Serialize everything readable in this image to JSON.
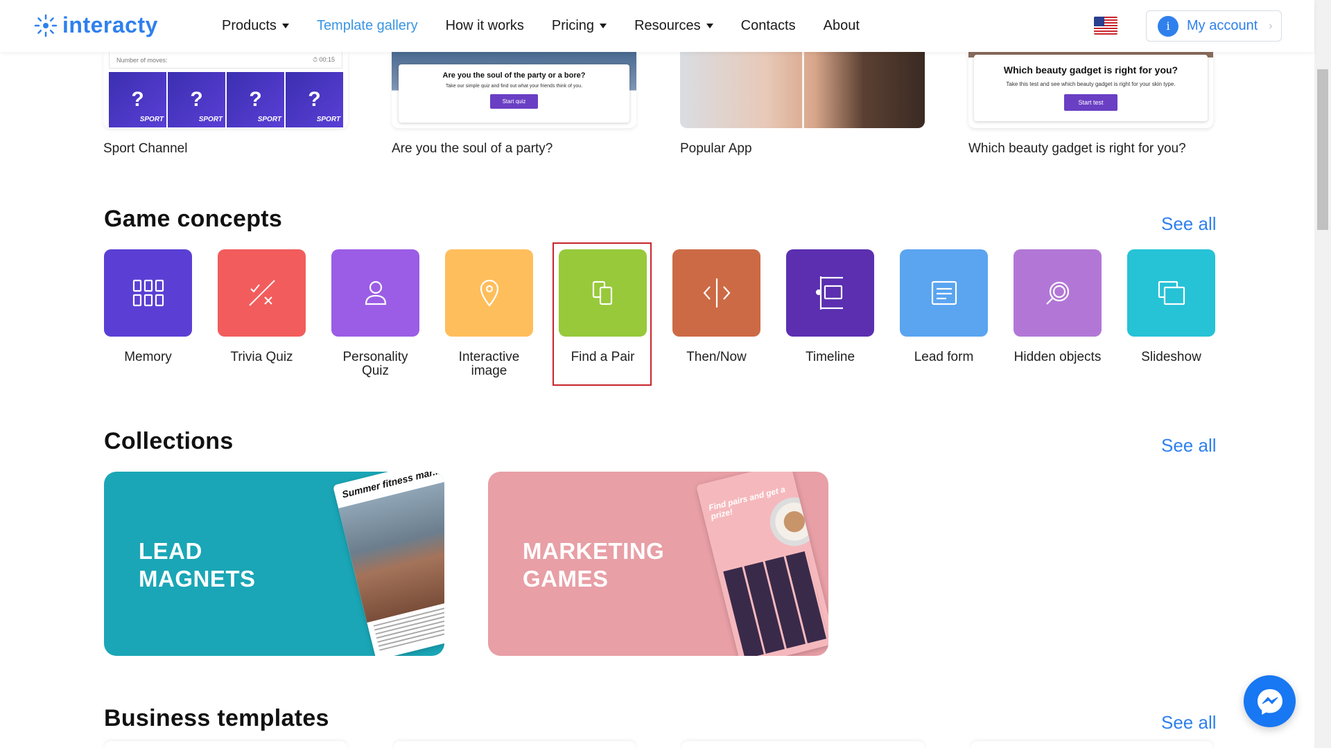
{
  "header": {
    "logo_text": "interacty",
    "nav": [
      {
        "label": "Products",
        "dropdown": true
      },
      {
        "label": "Template gallery",
        "dropdown": false,
        "active": true
      },
      {
        "label": "How it works",
        "dropdown": false
      },
      {
        "label": "Pricing",
        "dropdown": true
      },
      {
        "label": "Resources",
        "dropdown": true
      },
      {
        "label": "Contacts",
        "dropdown": false
      },
      {
        "label": "About",
        "dropdown": false
      }
    ],
    "account_icon_letter": "i",
    "account_label": "My account",
    "accent_color": "#2f80ed"
  },
  "top_templates": [
    {
      "label": "Sport Channel",
      "moves_label": "Number of moves:",
      "timer": "00:15",
      "tile_mark": "?",
      "tile_brand": "SPORT"
    },
    {
      "label": "Are you the soul of a party?",
      "quiz_title": "Are you the soul of the party or a bore?",
      "quiz_subtitle": "Take our simple quiz and find out what your friends think of you.",
      "button": "Start quiz"
    },
    {
      "label": "Popular App"
    },
    {
      "label": "Which beauty gadget is right for you?",
      "quiz_title": "Which beauty gadget is right for you?",
      "quiz_subtitle": "Take this test and see which beauty gadget is right for your skin type.",
      "button": "Start test"
    }
  ],
  "game_concepts": {
    "title": "Game concepts",
    "see_all": "See all",
    "items": [
      {
        "label": "Memory",
        "icon": "grid-icon",
        "color": "#5b3fd4"
      },
      {
        "label": "Trivia Quiz",
        "icon": "check-cross-icon",
        "color": "#f25c5c"
      },
      {
        "label": "Personality Quiz",
        "icon": "person-icon",
        "color": "#9b5de5"
      },
      {
        "label": "Interactive image",
        "icon": "map-pin-icon",
        "color": "#ffbe5c"
      },
      {
        "label": "Find a Pair",
        "icon": "cards-pair-icon",
        "color": "#97c93a",
        "highlighted": true
      },
      {
        "label": "Then/Now",
        "icon": "split-arrows-icon",
        "color": "#cc6a45"
      },
      {
        "label": "Timeline",
        "icon": "timeline-icon",
        "color": "#5b2fb0"
      },
      {
        "label": "Lead form",
        "icon": "form-icon",
        "color": "#5aa4f0"
      },
      {
        "label": "Hidden objects",
        "icon": "magnifier-icon",
        "color": "#b277d6"
      },
      {
        "label": "Slideshow",
        "icon": "slides-icon",
        "color": "#26c2d6"
      }
    ]
  },
  "collections": {
    "title": "Collections",
    "see_all": "See all",
    "items": [
      {
        "line1": "LEAD",
        "line2": "MAGNETS",
        "color": "#1aa6b6",
        "preview_text": "Summer fitness mar..."
      },
      {
        "line1": "MARKETING",
        "line2": "GAMES",
        "color": "#e89fa6",
        "preview_text": "Find pairs and get a prize!"
      }
    ]
  },
  "business_templates": {
    "title": "Business templates",
    "see_all": "See all"
  },
  "messenger_icon": "messenger-icon"
}
